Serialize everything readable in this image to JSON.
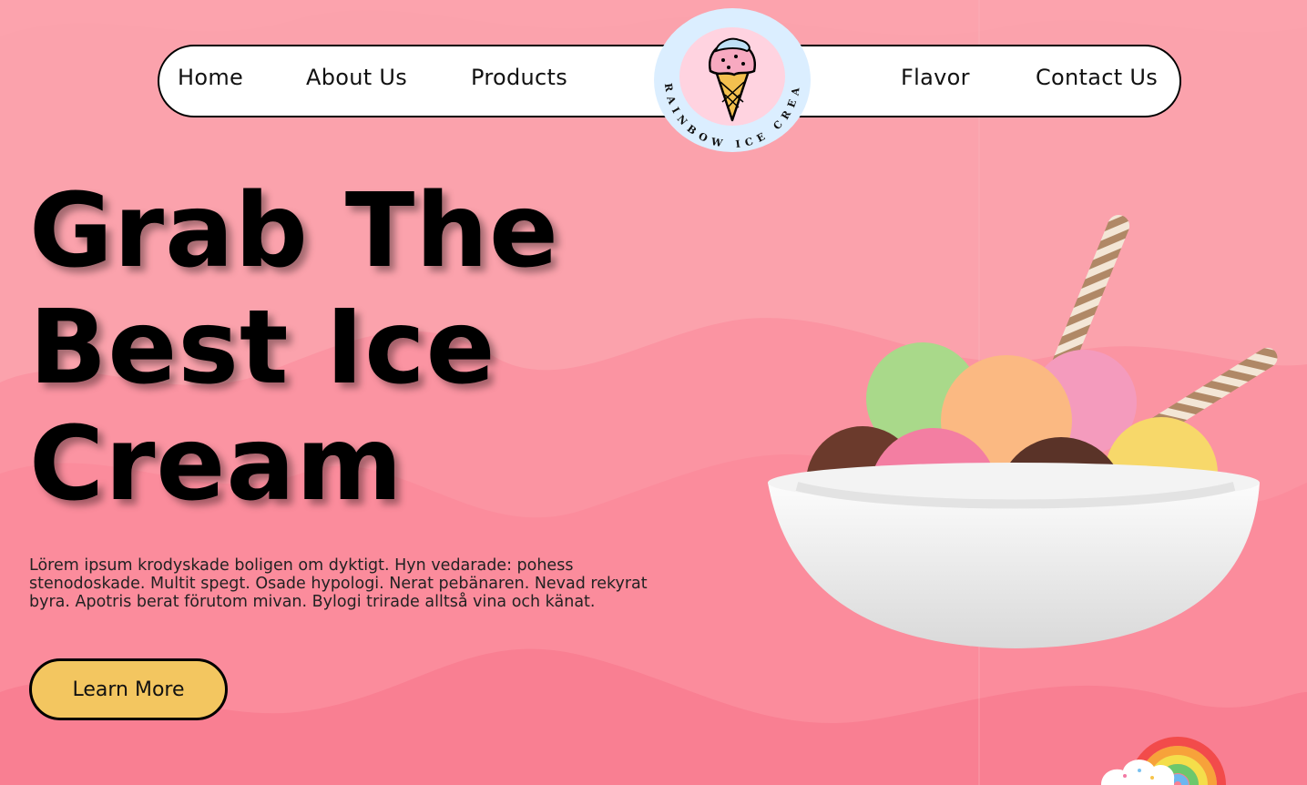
{
  "brand": {
    "name": "RAINBOW ICE CREAM",
    "logo_icon": "ice-cream-cone-icon"
  },
  "nav": {
    "items": [
      {
        "label": "Home"
      },
      {
        "label": "About Us"
      },
      {
        "label": "Products"
      },
      {
        "label": "Flavor"
      },
      {
        "label": "Contact Us"
      }
    ]
  },
  "hero": {
    "title_lines": [
      "Grab The",
      "Best Ice",
      "Cream"
    ],
    "description": "Lörem ipsum krodyskade boligen om dyktigt. Hyn vedarade: pohess stenodoskade. Multit spegt. Osade hypologi. Nerat pebänaren. Nevad rekyrat byra. Apotris berat förutom mivan. Bylogi trirade alltså vina och känat.",
    "cta_label": "Learn More",
    "image_icon": "ice-cream-bowl-image",
    "decor_icon": "rainbow-cloud-icon"
  },
  "colors": {
    "background": "#fca3ad",
    "wave": "#fb8c9c",
    "cta": "#f3c660",
    "logo_ring": "#dbeeff",
    "logo_inner": "#ffd3e0"
  }
}
